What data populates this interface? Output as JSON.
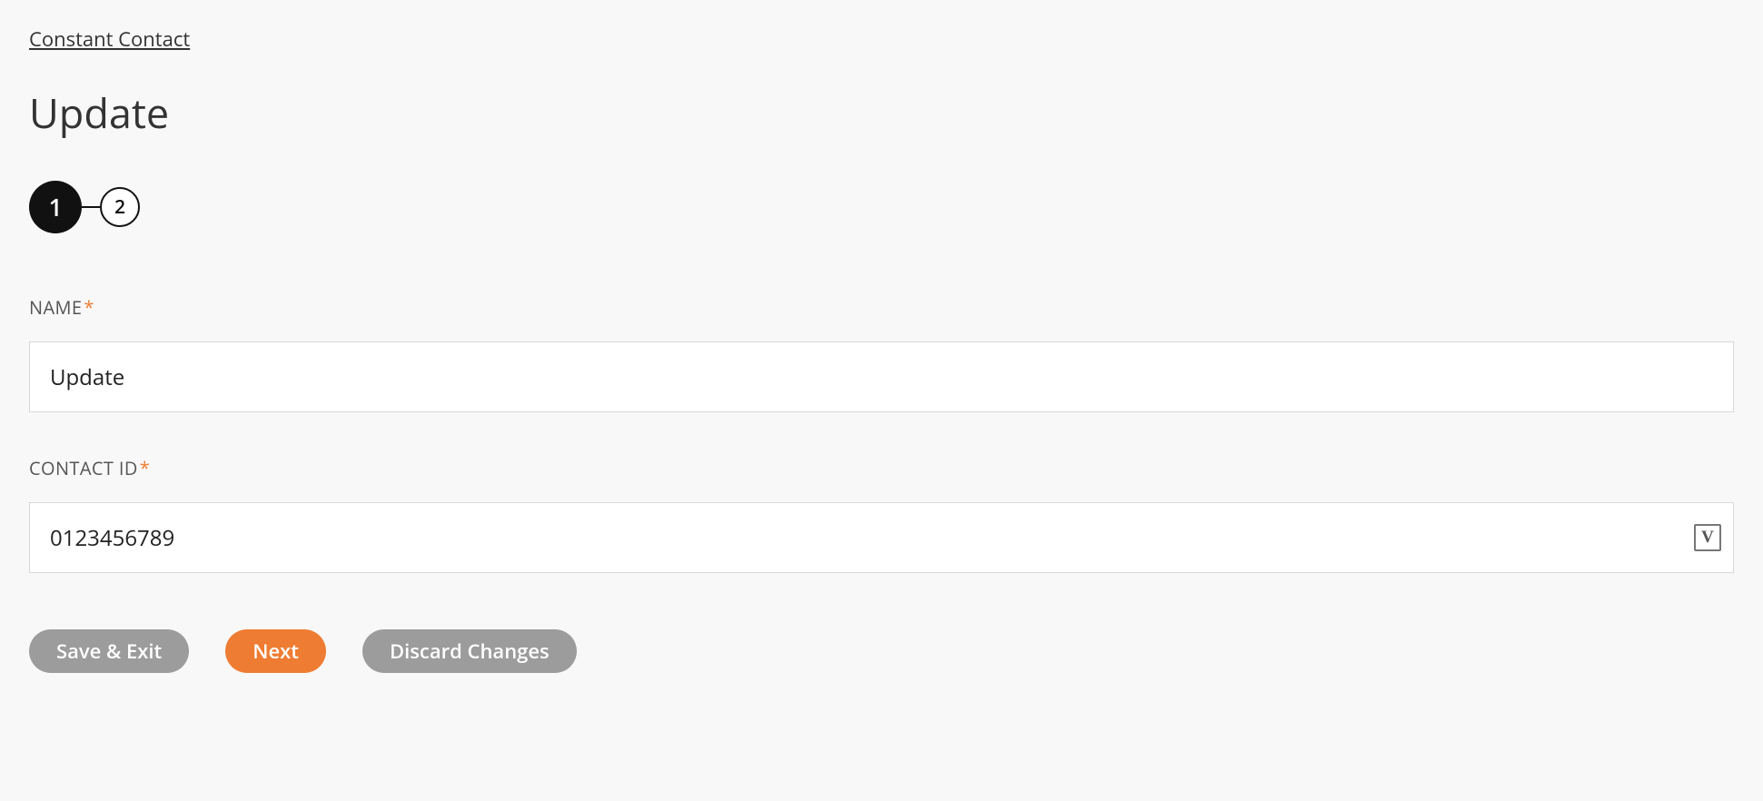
{
  "breadcrumb": {
    "label": "Constant Contact"
  },
  "title": "Update",
  "stepper": {
    "steps": [
      {
        "number": "1",
        "active": true
      },
      {
        "number": "2",
        "active": false
      }
    ]
  },
  "fields": {
    "name": {
      "label": "NAME",
      "required_mark": "*",
      "value": "Update"
    },
    "contact_id": {
      "label": "CONTACT ID",
      "required_mark": "*",
      "value": "0123456789",
      "badge": "V"
    }
  },
  "buttons": {
    "save_exit": "Save & Exit",
    "next": "Next",
    "discard": "Discard Changes"
  }
}
